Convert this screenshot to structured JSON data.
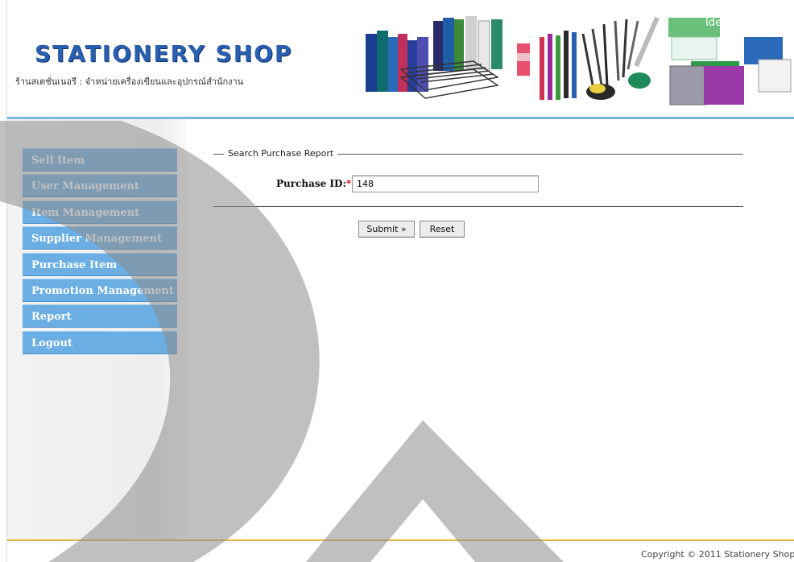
{
  "header": {
    "title": "STATIONERY SHOP",
    "subtitle": "ร้านสเตชั่นเนอรี : จำหน่ายเครื่องเขียนและอุปกรณ์สำนักงาน",
    "banner_brand": "Idea"
  },
  "sidebar": {
    "items": [
      {
        "label": "Sell Item"
      },
      {
        "label": "User Management"
      },
      {
        "label": "Item Management"
      },
      {
        "label": "Supplier Management"
      },
      {
        "label": "Purchase Item"
      },
      {
        "label": "Promotion Management"
      },
      {
        "label": "Report"
      },
      {
        "label": "Logout"
      }
    ]
  },
  "form": {
    "legend": "Search Purchase Report",
    "purchase_id_label": "Purchase ID:",
    "required_mark": "*",
    "purchase_id_value": "148",
    "submit_label": "Submit »",
    "reset_label": "Reset"
  },
  "footer": {
    "copyright": "Copyright © 2011 Stationery Shop"
  },
  "colors": {
    "menu_bg": "#6aaee3",
    "header_rule": "#7ab6dd",
    "footer_rule": "#e4b343",
    "logo": "#2a5fb0"
  }
}
